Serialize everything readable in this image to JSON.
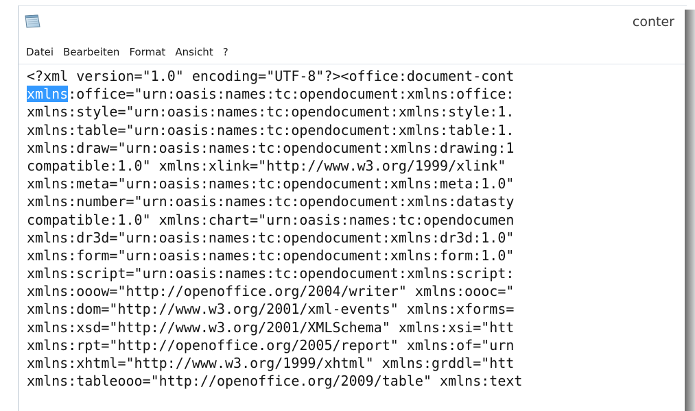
{
  "window": {
    "title": "conter"
  },
  "icons": {
    "app": "notepad-icon"
  },
  "menu": {
    "items": [
      "Datei",
      "Bearbeiten",
      "Format",
      "Ansicht",
      "?"
    ]
  },
  "editor": {
    "selected_text": "xmlns",
    "line1": "<?xml version=\"1.0\" encoding=\"UTF-8\"?><office:document-cont",
    "line2_rest": ":office=\"urn:oasis:names:tc:opendocument:xmlns:office:",
    "lines": [
      "xmlns:style=\"urn:oasis:names:tc:opendocument:xmlns:style:1.",
      "xmlns:table=\"urn:oasis:names:tc:opendocument:xmlns:table:1.",
      "xmlns:draw=\"urn:oasis:names:tc:opendocument:xmlns:drawing:1",
      "compatible:1.0\" xmlns:xlink=\"http://www.w3.org/1999/xlink\"",
      "xmlns:meta=\"urn:oasis:names:tc:opendocument:xmlns:meta:1.0\"",
      "xmlns:number=\"urn:oasis:names:tc:opendocument:xmlns:datasty",
      "compatible:1.0\" xmlns:chart=\"urn:oasis:names:tc:opendocumen",
      "xmlns:dr3d=\"urn:oasis:names:tc:opendocument:xmlns:dr3d:1.0\"",
      "xmlns:form=\"urn:oasis:names:tc:opendocument:xmlns:form:1.0\"",
      "xmlns:script=\"urn:oasis:names:tc:opendocument:xmlns:script:",
      "xmlns:ooow=\"http://openoffice.org/2004/writer\" xmlns:oooc=\"",
      "xmlns:dom=\"http://www.w3.org/2001/xml-events\" xmlns:xforms=",
      "xmlns:xsd=\"http://www.w3.org/2001/XMLSchema\" xmlns:xsi=\"htt",
      "xmlns:rpt=\"http://openoffice.org/2005/report\" xmlns:of=\"urn",
      "xmlns:xhtml=\"http://www.w3.org/1999/xhtml\" xmlns:grddl=\"htt",
      "xmlns:tableooo=\"http://openoffice.org/2009/table\" xmlns:text"
    ]
  },
  "colors": {
    "selection": "#3399ff",
    "text": "#141414",
    "border": "#b9c4d0"
  }
}
